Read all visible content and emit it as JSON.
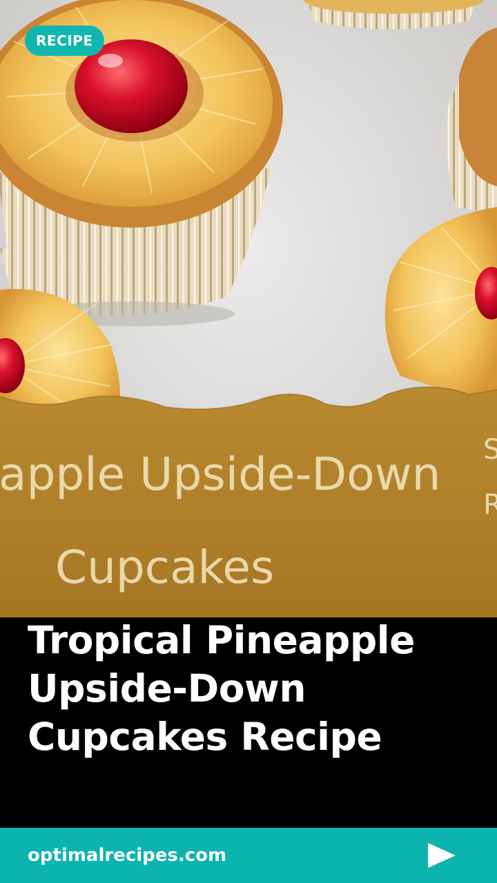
{
  "badge": {
    "label": "RECIPE"
  },
  "hero_image": {
    "banner_line_1": "apple Upside-Down",
    "banner_line_2": "Cupcakes",
    "banner_edge_1": "S",
    "banner_edge_2": "R"
  },
  "story": {
    "title_line_1": "Tropical Pineapple",
    "title_line_2": "Upside-Down",
    "title_line_3": "Cupcakes Recipe"
  },
  "footer": {
    "site": "optimalrecipes.com",
    "next_icon": "play-arrow-icon"
  },
  "colors": {
    "accent": "#0cb4b0",
    "background": "#000000",
    "banner": "#b3842c"
  }
}
